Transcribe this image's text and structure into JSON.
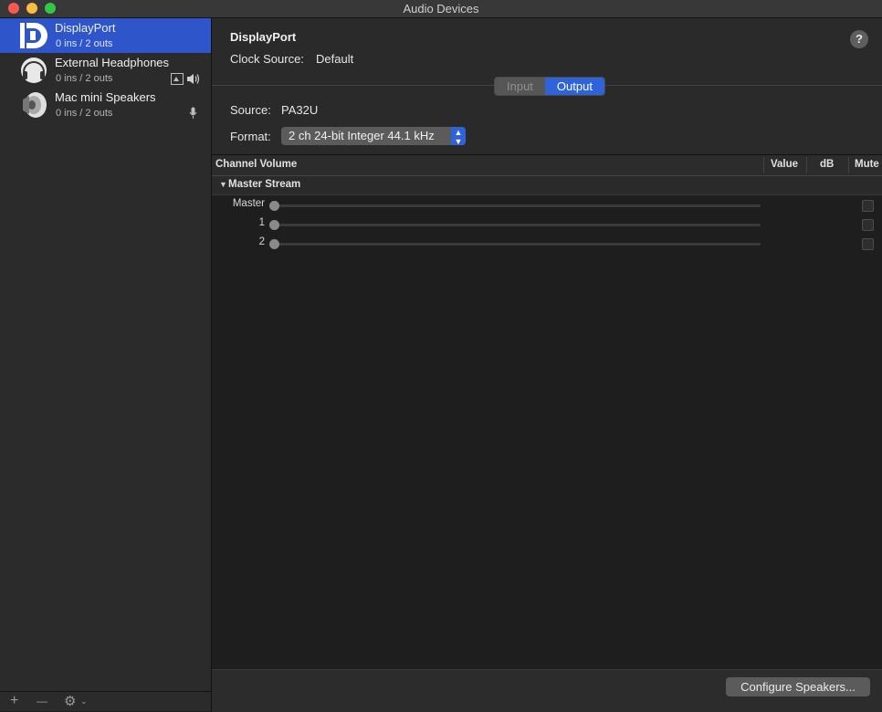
{
  "window": {
    "title": "Audio Devices"
  },
  "sidebar": {
    "devices": [
      {
        "name": "DisplayPort",
        "io": "0 ins / 2 outs",
        "icon": "displayport-icon",
        "selected": true
      },
      {
        "name": "External Headphones",
        "io": "0 ins / 2 outs",
        "icon": "headphones-icon",
        "badges": [
          "finder-icon",
          "speaker-icon"
        ]
      },
      {
        "name": "Mac mini Speakers",
        "io": "0 ins / 2 outs",
        "icon": "speaker-cone-icon",
        "badges": [
          "microphone-icon"
        ]
      }
    ],
    "footer": {
      "add": "+",
      "remove": "—",
      "gear": "⚙"
    }
  },
  "detail": {
    "device_name": "DisplayPort",
    "clock_source_label": "Clock Source:",
    "clock_source_value": "Default",
    "help": "?",
    "tabs": {
      "input": "Input",
      "output": "Output",
      "selected": "Output"
    },
    "source_label": "Source:",
    "source_value": "PA32U",
    "format_label": "Format:",
    "format_value": "2 ch 24-bit Integer 44.1 kHz"
  },
  "table": {
    "headers": {
      "channel": "Channel Volume",
      "value": "Value",
      "db": "dB",
      "mute": "Mute"
    },
    "group": "Master Stream",
    "channels": [
      {
        "label": "Master",
        "level": 0
      },
      {
        "label": "1",
        "level": 0
      },
      {
        "label": "2",
        "level": 0
      }
    ]
  },
  "bottom": {
    "configure": "Configure Speakers..."
  },
  "colors": {
    "accent": "#2f63d8",
    "selection": "#2e55c9"
  }
}
